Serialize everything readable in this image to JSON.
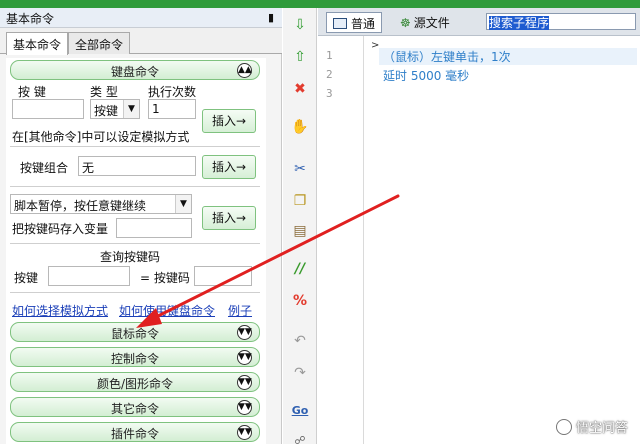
{
  "panel": {
    "title": "基本命令",
    "pin_icon": "pin-icon"
  },
  "tabs": [
    {
      "label": "基本命令",
      "active": true
    },
    {
      "label": "全部命令",
      "active": false
    }
  ],
  "keyboard": {
    "header": "键盘命令",
    "col_key": "按 键",
    "col_type": "类 型",
    "col_times": "执行次数",
    "type_value": "按键",
    "times_value": "1",
    "insert_label": "插入→",
    "hint": "在[其他命令]中可以设定模拟方式",
    "combo_label": "按键组合",
    "combo_value": "无",
    "pause_option": "脚本暂停，按任意键继续",
    "save_var_label": "把按键码存入变量",
    "query_title": "查询按键码",
    "query_key_label": "按键",
    "query_code_label": "= 按键码"
  },
  "links": [
    "如何选择模拟方式",
    "如何使用键盘命令",
    "例子"
  ],
  "groups": [
    "鼠标命令",
    "控制命令",
    "颜色/图形命令",
    "其它命令",
    "插件命令"
  ],
  "toolbar_icons": [
    "arrow-down-icon",
    "arrow-up-icon",
    "delete-icon",
    "hand-icon",
    "cut-icon",
    "copy-icon",
    "paste-icon",
    "comment-icon",
    "uncomment-icon",
    "undo-icon",
    "redo-icon",
    "goto-icon",
    "find-icon"
  ],
  "editor": {
    "tab_normal": "普通",
    "tab_source": "源文件",
    "search_text": "搜索子程序",
    "line_numbers": [
      "1",
      "2",
      "3"
    ],
    "lines": [
      "（鼠标）左键单击，1次",
      "延时 5000 毫秒",
      ""
    ]
  },
  "watermark": "悟空问答",
  "colors": {
    "accent_green": "#2f9b3b",
    "arrow_red": "#e02020",
    "code_blue": "#2f7fc9"
  }
}
